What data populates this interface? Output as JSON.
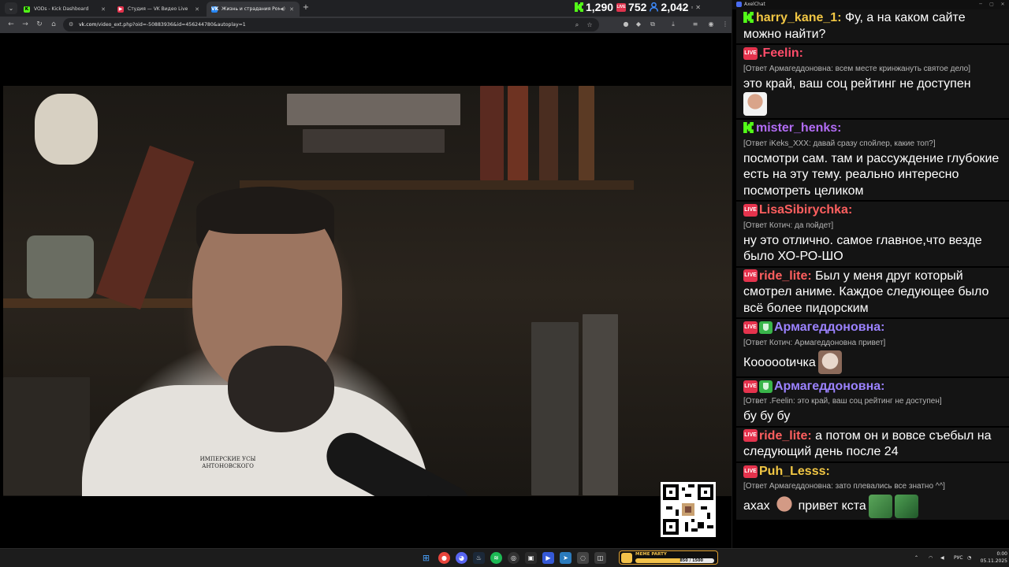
{
  "browser": {
    "tabs": [
      {
        "title": "VODs - Kick Dashboard",
        "favicon": "kick-icon",
        "active": false
      },
      {
        "title": "Студия — VK Видео Live",
        "favicon": "vk-live-icon",
        "active": false
      },
      {
        "title": "Жизнь и страдания Романа",
        "favicon": "vk-icon",
        "active": true
      }
    ],
    "url_host": "vk.com",
    "url_path": "/video_ext.php?oid=-50883936&id=456244780&autoplay=1"
  },
  "stream_stats": {
    "kick_viewers": "1,290",
    "vk_live_viewers": "752",
    "total_viewers": "2,042",
    "live_badge": "LIVE"
  },
  "video": {
    "shirt_text": "ИМПЕРСКИЕ УСЫ АНТОНОВСКОГО"
  },
  "chat": {
    "app_name": "AxelChat",
    "messages": [
      {
        "platform": "kick",
        "user": "harry_kane_1:",
        "color": "#f2c744",
        "reply": "",
        "text": "Фу, а на каком сайте можно найти?"
      },
      {
        "platform": "live",
        "user": ".Feelin:",
        "color": "#ff4d4d",
        "reply": "[Ответ Армагеддоновна: всем месте кринжануть святое дело]",
        "text": "это край, ваш соц рейтинг не доступен",
        "emote": "face-emote"
      },
      {
        "platform": "kick",
        "user": "mister_henks:",
        "color": "#b26cf5",
        "reply": "[Ответ iKeks_XXX: давай сразу спойлер, какие топ?]",
        "text": "посмотри сам. там и рассуждение глубокие есть на эту тему. реально интересно посмотреть целиком"
      },
      {
        "platform": "live",
        "user": "LisaSibirychka:",
        "color": "#ff5f5f",
        "reply": "[Ответ Котич: да пойдет]",
        "text": "ну это отлично. самое главное,что везде было ХО-РО-ШО"
      },
      {
        "platform": "live",
        "user": "ride_lite:",
        "color": "#ff5f5f",
        "reply": "",
        "text": "Был у меня друг который смотрел аниме. Каждое следующее было всё более пидорским"
      },
      {
        "platform": "live-mod",
        "user": "Армагеддоновна:",
        "color": "#9b82ff",
        "reply": "[Ответ Котич: Армагеддоновна привет]",
        "text": "Коооootичка",
        "emote": "cat-emote"
      },
      {
        "platform": "live-mod",
        "user": "Армагеддоновна:",
        "color": "#9b82ff",
        "reply": "[Ответ .Feelin: это край, ваш соц рейтинг не доступен]",
        "text": "бу бу бу"
      },
      {
        "platform": "live",
        "user": "ride_lite:",
        "color": "#ff5f5f",
        "reply": "",
        "text": "а потом он и вовсе съебыл на следующий день после 24"
      },
      {
        "platform": "live",
        "user": "Puh_Lesss:",
        "color": "#f2c744",
        "reply": "[Ответ Армагеддоновна: зато плевались все знатно ^^]",
        "text": "ахах",
        "text2": "привет кста"
      }
    ]
  },
  "taskbar": {
    "memeparty_label": "MEME PARTY",
    "memeparty_count": "850 / 1500",
    "memeparty_progress": 0.57,
    "lang": "РУС",
    "time": "0:00",
    "date": "05.11.2025"
  },
  "colors": {
    "kick_green": "#53fc18",
    "vk_live_red": "#e5334d",
    "chat_bg": "#141414"
  }
}
